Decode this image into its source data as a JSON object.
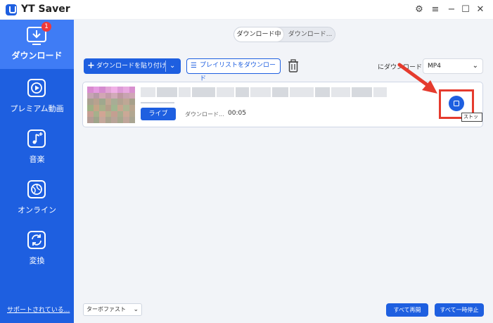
{
  "app": {
    "title": "YT Saver"
  },
  "window_controls": {
    "settings": "⚙",
    "menu": "≡",
    "minimize": "−",
    "maximize": "☐",
    "close": "✕"
  },
  "sidebar": {
    "badge_count": "1",
    "items": [
      {
        "label": "ダウンロード",
        "icon": "download-icon",
        "active": true
      },
      {
        "label": "プレミアム動画",
        "icon": "play-icon",
        "active": false
      },
      {
        "label": "音楽",
        "icon": "music-icon",
        "active": false
      },
      {
        "label": "オンライン",
        "icon": "globe-icon",
        "active": false
      },
      {
        "label": "変換",
        "icon": "convert-icon",
        "active": false
      }
    ],
    "support_link": "サポートされている..."
  },
  "tabs": {
    "downloading": "ダウンロード中",
    "downloaded": "ダウンロード..."
  },
  "toolbar": {
    "paste_button": "ダウンロードを貼り付け",
    "playlist_button": "プレイリストをダウンロード",
    "format_label": "にダウンロード",
    "format_value": "MP4"
  },
  "download_item": {
    "live_label": "ライブ",
    "status": "ダウンロード...",
    "time": "00:05",
    "stop_tooltip": "ストップ"
  },
  "footer": {
    "speed_value": "ターボファスト",
    "resume_all": "すべて再開",
    "pause_all": "すべて一時停止"
  },
  "colors": {
    "accent": "#1e5fe0",
    "sidebar_active": "#3f7cf5",
    "highlight": "#e53b2e",
    "badge": "#f0393a"
  }
}
